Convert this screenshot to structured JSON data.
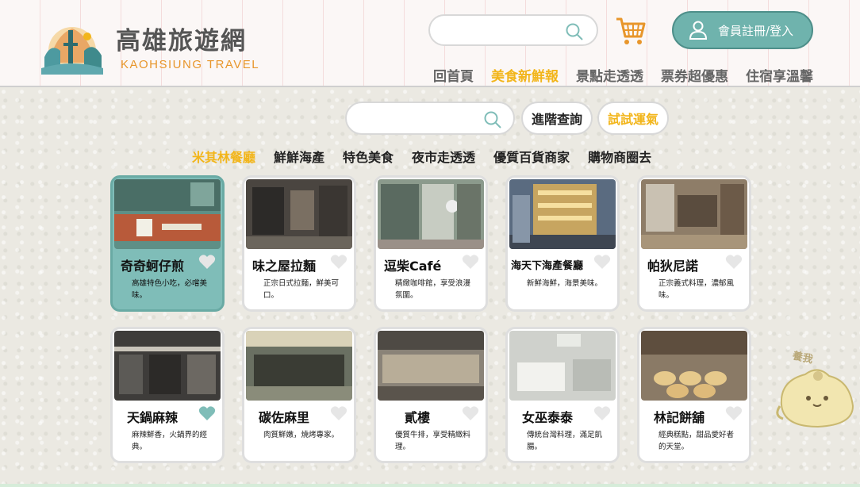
{
  "header": {
    "title": "高雄旅遊網",
    "subtitle": "KAOHSIUNG TRAVEL",
    "member_label": "會員註冊/登入",
    "nav": [
      "回首頁",
      "美食新鮮報",
      "景點走透透",
      "票券超優惠",
      "住宿享溫馨"
    ],
    "active_nav": "美食新鮮報"
  },
  "search": {
    "top_placeholder": "",
    "mid_placeholder": "",
    "advanced_label": "進階查詢",
    "luck_label": "試試運氣"
  },
  "categories": [
    "米其林餐廳",
    "鮮鮮海產",
    "特色美食",
    "夜市走透透",
    "優質百貨商家",
    "購物商圈去"
  ],
  "active_category": "米其林餐廳",
  "cards": [
    {
      "name": "奇奇蚵仔煎",
      "desc": "高雄特色小吃，必嚐美味。",
      "favorited": false,
      "selected": true
    },
    {
      "name": "味之屋拉麵",
      "desc": "正宗日式拉麵，鮮美可口。",
      "favorited": false,
      "selected": false
    },
    {
      "name": "逗柴Café",
      "desc": "精緻咖啡館，享受浪漫氛圍。",
      "favorited": false,
      "selected": false
    },
    {
      "name": "海天下海產餐廳",
      "desc": "新鮮海鮮，海景美味。",
      "favorited": false,
      "selected": false
    },
    {
      "name": "帕狄尼諾",
      "desc": "正宗義式料理，濃郁風味。",
      "favorited": false,
      "selected": false
    },
    {
      "name": "天鍋麻辣",
      "desc": "麻辣鮮香，火鍋界的經典。",
      "favorited": true,
      "selected": false
    },
    {
      "name": "碳佐麻里",
      "desc": "肉質鮮嫩，燒烤專家。",
      "favorited": false,
      "selected": false
    },
    {
      "name": "貳樓",
      "desc": "優質牛排，享受精緻料理。",
      "favorited": false,
      "selected": false
    },
    {
      "name": "女巫泰泰",
      "desc": "傳統台灣料理，滿足飢腸。",
      "favorited": false,
      "selected": false
    },
    {
      "name": "林記餅舖",
      "desc": "經典糕點，甜品愛好者的天堂。",
      "favorited": false,
      "selected": false
    }
  ],
  "mascot_text": "養我",
  "colors": {
    "accent_yellow": "#f2b51a",
    "teal": "#6fb3ad",
    "cart_orange": "#e8962b"
  }
}
